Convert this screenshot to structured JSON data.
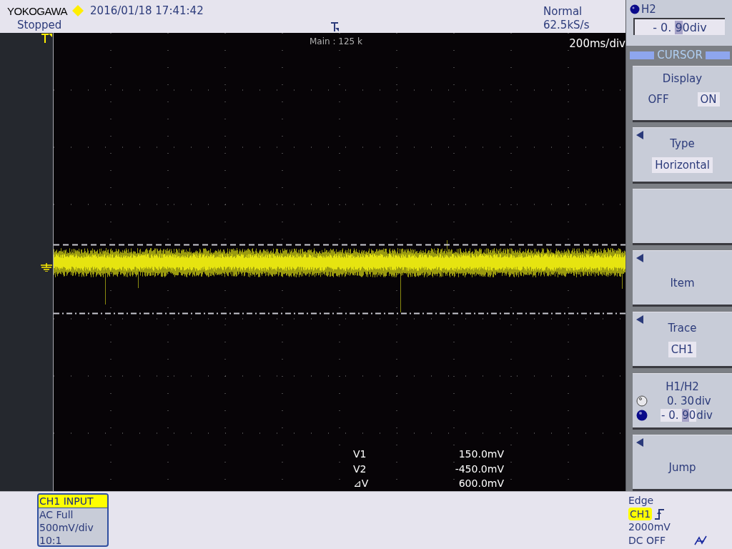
{
  "top_bar": {
    "brand": "YOKOGAWA",
    "datetime": "2016/01/18 17:41:42",
    "run_state": "Stopped",
    "trigger_mode": "Normal",
    "sample_rate": "62.5kS/s"
  },
  "screen": {
    "record_length": "Main : 125 k",
    "timebase": "200ms/div",
    "readouts": [
      {
        "label": "V1",
        "value": "150.0mV"
      },
      {
        "label": "V2",
        "value": "-450.0mV"
      },
      {
        "label": "⊿V",
        "value": "600.0mV"
      }
    ]
  },
  "jog_field": {
    "label": "H2",
    "value_parts": [
      {
        "text": "- 0. ",
        "selected": false
      },
      {
        "text": "9",
        "selected": true
      },
      {
        "text": "0",
        "selected": false
      }
    ],
    "unit": "div"
  },
  "menu": {
    "title": "CURSOR",
    "softkeys": [
      {
        "kind": "toggle",
        "title": "Display",
        "arrow": false,
        "options": [
          {
            "label": "OFF",
            "selected": false
          },
          {
            "label": "ON",
            "selected": true
          }
        ]
      },
      {
        "kind": "select",
        "title": "Type",
        "arrow": true,
        "value": "Horizontal"
      },
      {
        "kind": "blank",
        "arrow": false
      },
      {
        "kind": "action",
        "title": "Item",
        "arrow": true
      },
      {
        "kind": "select",
        "title": "Trace",
        "arrow": true,
        "value": "CH1"
      },
      {
        "kind": "values",
        "title": "H1/H2",
        "arrow": false,
        "rows": [
          {
            "active": false,
            "value_parts": [
              {
                "text": "0. 30",
                "selected": false
              }
            ],
            "unit": "div"
          },
          {
            "active": true,
            "value_parts": [
              {
                "text": "- 0. ",
                "selected": false
              },
              {
                "text": "9",
                "selected": true
              },
              {
                "text": "0",
                "selected": false
              }
            ],
            "unit": "div"
          }
        ]
      },
      {
        "kind": "action",
        "title": "Jump",
        "arrow": true
      }
    ]
  },
  "channel_box": {
    "title": "CH1 INPUT",
    "lines": [
      "AC Full",
      "500mV/div",
      "10:1"
    ]
  },
  "trigger": {
    "type": "Edge",
    "source": "CH1",
    "level": "2000mV",
    "coupling": "DC OFF"
  }
}
